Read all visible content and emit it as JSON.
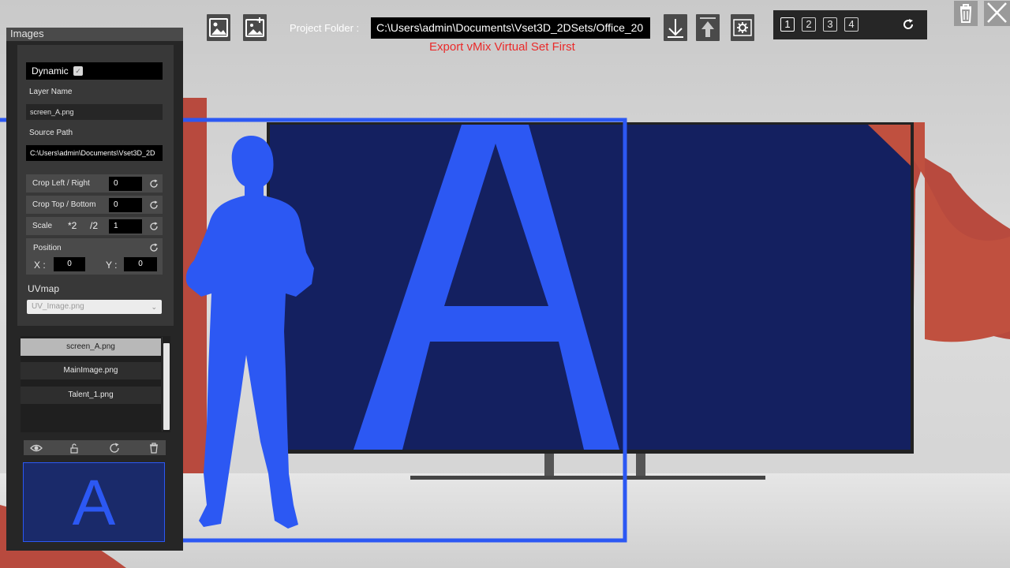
{
  "panel": {
    "title": "Images",
    "dynamic_label": "Dynamic",
    "dynamic_checked": true,
    "layer_name_label": "Layer Name",
    "layer_name_value": "screen_A.png",
    "source_path_label": "Source Path",
    "source_path_value": "C:\\Users\\admin\\Documents\\Vset3D_2D",
    "crop_lr_label": "Crop Left / Right",
    "crop_lr_value": "0",
    "crop_tb_label": "Crop Top / Bottom",
    "crop_tb_value": "0",
    "scale_label": "Scale",
    "scale_double_label": "*2",
    "scale_half_label": "/2",
    "scale_value": "1",
    "position_label": "Position",
    "x_label": "X :",
    "x_value": "0",
    "y_label": "Y :",
    "y_value": "0",
    "uvmap_label": "UVmap",
    "uvmap_selected": "UV_Image.png",
    "layers": [
      "screen_A.png",
      "MainImage.png",
      "Talent_1.png"
    ],
    "selected_layer_index": 0,
    "preview_letter": "A"
  },
  "toolbar": {
    "project_folder_label": "Project Folder :",
    "project_folder_value": "C:\\Users\\admin\\Documents\\Vset3D_2DSets/Office_20",
    "export_warning": "Export vMix Virtual Set First",
    "layer_numbers": [
      "1",
      "2",
      "3",
      "4"
    ],
    "active_layer": "1"
  },
  "scene": {
    "screen_letter": "A"
  },
  "icons": {
    "add_image": "image-icon",
    "add_image_alt": "image-plus-icon",
    "import": "download-arrow-icon",
    "export": "upload-arrow-icon",
    "settings": "gear-icon",
    "refresh": "refresh-icon",
    "delete": "trash-icon",
    "close": "close-icon",
    "visibility": "eye-icon",
    "lock": "lock-icon"
  },
  "colors": {
    "accent_blue": "#2c58f3",
    "screen_navy": "#142060",
    "warning_red": "#ea2a2a",
    "wall_red": "#b84a3e"
  }
}
